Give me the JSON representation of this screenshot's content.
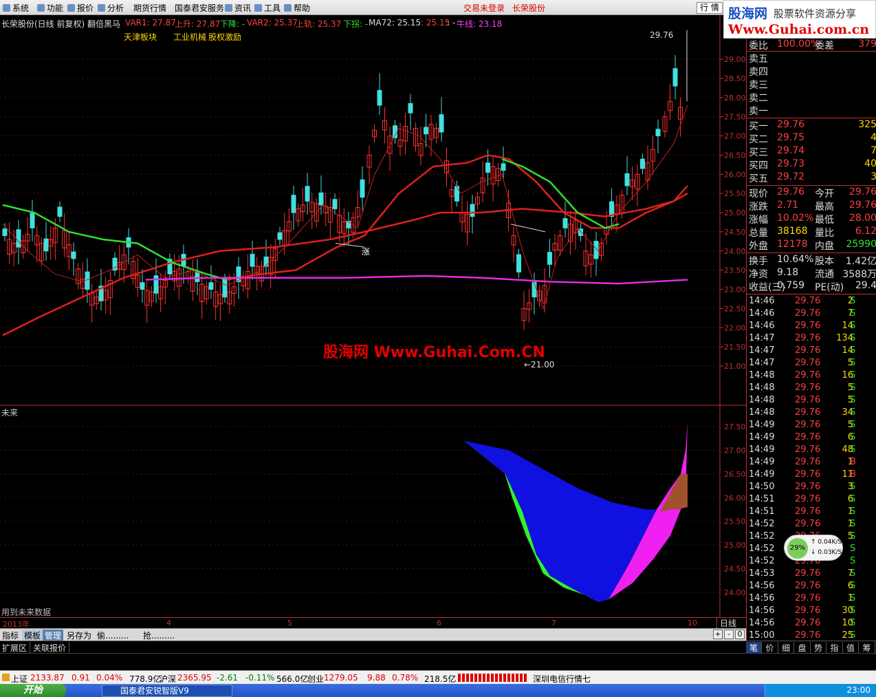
{
  "menu": {
    "items": [
      "系统",
      "功能",
      "报价",
      "分析",
      "期货行情",
      "国泰君安服务",
      "资讯",
      "工具",
      "帮助"
    ],
    "login_status": "交易未登录",
    "stock_name": "长荣股份",
    "hangqing": "行 情"
  },
  "logo": {
    "line1": "股海网",
    "line2": "股票软件资源分享",
    "line3": "Www.Guhai.com.cn"
  },
  "chart": {
    "title": "长荣股份(日线 前复权) 翻倍黑马",
    "indicators": [
      {
        "text": "VAR1: 27.87",
        "color": "#ff4040"
      },
      {
        "text": "上升: 27.87",
        "color": "#ff4040"
      },
      {
        "text": "下降: -",
        "color": "#30e030"
      },
      {
        "text": "VAR2: 25.37",
        "color": "#ff4040"
      },
      {
        "text": "上轨: 25.37",
        "color": "#ff4040"
      },
      {
        "text": "下拐: -",
        "color": "#30e030"
      },
      {
        "text": "MA72: 25.15",
        "color": "#dddddd"
      },
      {
        "text": ": 25.15",
        "color": "#ff4040"
      },
      {
        "text": ": -",
        "color": "#dddddd"
      },
      {
        "text": "牛线: 23.18",
        "color": "#ff40ff"
      }
    ],
    "blocks": [
      "天津板块",
      "工业机械",
      "股权激励"
    ],
    "high_label": "29.76",
    "low_label": "←21.00",
    "zhang_label": "涨",
    "watermark": "股海网 Www.Guhai.Com.CN",
    "price_axis": [
      "29.00",
      "28.50",
      "28.00",
      "27.50",
      "27.00",
      "26.50",
      "26.00",
      "25.50",
      "25.00",
      "24.50",
      "24.00",
      "23.50",
      "23.00",
      "22.50",
      "22.00",
      "21.50",
      "21.00"
    ],
    "future_axis": [
      "27.50",
      "27.00",
      "26.50",
      "26.00",
      "25.50",
      "25.00",
      "24.50",
      "24.00"
    ],
    "future_label": "未来",
    "future_note": "用到未来数据",
    "dates": [
      "2013年",
      "4",
      "5",
      "6",
      "7",
      "10"
    ],
    "period": "日线"
  },
  "tabs1": [
    "指标",
    "模板",
    "管理",
    "另存为",
    "偷.........",
    "抢........."
  ],
  "tabs1_buttons": [
    "+",
    "-",
    "0"
  ],
  "tabs2": [
    "扩展区",
    "关联报价"
  ],
  "quote": {
    "weibi": {
      "label": "委比",
      "value": "100.00%",
      "label2": "委差",
      "value2": "379"
    },
    "sell": [
      {
        "label": "卖五"
      },
      {
        "label": "卖四"
      },
      {
        "label": "卖三"
      },
      {
        "label": "卖二"
      },
      {
        "label": "卖一"
      }
    ],
    "buy": [
      {
        "label": "买一",
        "price": "29.76",
        "vol": "325"
      },
      {
        "label": "买二",
        "price": "29.75",
        "vol": "4"
      },
      {
        "label": "买三",
        "price": "29.74",
        "vol": "7"
      },
      {
        "label": "买四",
        "price": "29.73",
        "vol": "40"
      },
      {
        "label": "买五",
        "price": "29.72",
        "vol": "3"
      }
    ],
    "stats": [
      {
        "k": "现价",
        "v": "29.76",
        "vc": "#ff4040",
        "k2": "今开",
        "v2": "29.76",
        "v2c": "#ff4040"
      },
      {
        "k": "涨跌",
        "v": "2.71",
        "vc": "#ff4040",
        "k2": "最高",
        "v2": "29.76",
        "v2c": "#ff4040"
      },
      {
        "k": "涨幅",
        "v": "10.02%",
        "vc": "#ff4040",
        "k2": "最低",
        "v2": "28.00",
        "v2c": "#ff4040"
      },
      {
        "k": "总量",
        "v": "38168",
        "vc": "#ffd700",
        "k2": "量比",
        "v2": "6.12",
        "v2c": "#ff4040"
      },
      {
        "k": "外盘",
        "v": "12178",
        "vc": "#ff4040",
        "k2": "内盘",
        "v2": "25990",
        "v2c": "#30e030"
      }
    ],
    "stats2": [
      {
        "k": "换手",
        "v": "10.64%",
        "vc": "#dddddd",
        "k2": "股本",
        "v2": "1.42亿",
        "v2c": "#dddddd"
      },
      {
        "k": "净资",
        "v": "9.18",
        "vc": "#dddddd",
        "k2": "流通",
        "v2": "3588万",
        "v2c": "#dddddd"
      },
      {
        "k": "收益(三)",
        "v": "0.759",
        "vc": "#dddddd",
        "k2": "PE(动)",
        "v2": "29.4",
        "v2c": "#dddddd"
      }
    ],
    "ticks": [
      {
        "t": "14:46",
        "p": "29.76",
        "v": "2",
        "bs": "S"
      },
      {
        "t": "14:46",
        "p": "29.76",
        "v": "7",
        "bs": "S"
      },
      {
        "t": "14:46",
        "p": "29.76",
        "v": "14",
        "bs": "S"
      },
      {
        "t": "14:47",
        "p": "29.76",
        "v": "134",
        "bs": "S"
      },
      {
        "t": "14:47",
        "p": "29.76",
        "v": "14",
        "bs": "S"
      },
      {
        "t": "14:47",
        "p": "29.76",
        "v": "5",
        "bs": "S"
      },
      {
        "t": "14:48",
        "p": "29.76",
        "v": "16",
        "bs": "S"
      },
      {
        "t": "14:48",
        "p": "29.76",
        "v": "5",
        "bs": "S"
      },
      {
        "t": "14:48",
        "p": "29.76",
        "v": "5",
        "bs": "S"
      },
      {
        "t": "14:48",
        "p": "29.76",
        "v": "34",
        "bs": "S"
      },
      {
        "t": "14:49",
        "p": "29.76",
        "v": "5",
        "bs": "S"
      },
      {
        "t": "14:49",
        "p": "29.76",
        "v": "6",
        "bs": "S"
      },
      {
        "t": "14:49",
        "p": "29.76",
        "v": "48",
        "bs": "S"
      },
      {
        "t": "14:49",
        "p": "29.76",
        "v": "1",
        "bs": "B"
      },
      {
        "t": "14:49",
        "p": "29.76",
        "v": "11",
        "bs": "B"
      },
      {
        "t": "14:50",
        "p": "29.76",
        "v": "3",
        "bs": "S"
      },
      {
        "t": "14:51",
        "p": "29.76",
        "v": "6",
        "bs": "S"
      },
      {
        "t": "14:51",
        "p": "29.76",
        "v": "1",
        "bs": "S"
      },
      {
        "t": "14:52",
        "p": "29.76",
        "v": "1",
        "bs": "S"
      },
      {
        "t": "14:52",
        "p": "29.76",
        "v": "5",
        "bs": "S"
      },
      {
        "t": "14:52",
        "p": "29.76",
        "v": "",
        "bs": "S"
      },
      {
        "t": "14:52",
        "p": "29.76",
        "v": "",
        "bs": "S"
      },
      {
        "t": "14:53",
        "p": "29.76",
        "v": "7",
        "bs": "S"
      },
      {
        "t": "14:56",
        "p": "29.76",
        "v": "6",
        "bs": "S"
      },
      {
        "t": "14:56",
        "p": "29.76",
        "v": "1",
        "bs": "S"
      },
      {
        "t": "14:56",
        "p": "29.76",
        "v": "30",
        "bs": "S"
      },
      {
        "t": "14:56",
        "p": "29.76",
        "v": "10",
        "bs": "S"
      },
      {
        "t": "15:00",
        "p": "29.76",
        "v": "25",
        "bs": "S"
      }
    ],
    "speed": {
      "pct": "29%",
      "up": "0.04K/S",
      "down": "0.03K/S"
    }
  },
  "rtabs": [
    "笔",
    "价",
    "细",
    "盘",
    "势",
    "指",
    "值",
    "筹"
  ],
  "status": [
    {
      "text": "上证",
      "c": "#000000"
    },
    {
      "text": "2133.87",
      "c": "#e00000"
    },
    {
      "text": "0.91",
      "c": "#e00000"
    },
    {
      "text": "0.04%",
      "c": "#e00000"
    },
    {
      "text": "778.9亿",
      "c": "#000000"
    },
    {
      "text": "沪深",
      "c": "#000000"
    },
    {
      "text": "2365.95",
      "c": "#e00000"
    },
    {
      "text": "-2.61",
      "c": "#008000"
    },
    {
      "text": "-0.11%",
      "c": "#008000"
    },
    {
      "text": "566.0亿",
      "c": "#000000"
    },
    {
      "text": "创业",
      "c": "#000000"
    },
    {
      "text": "1279.05",
      "c": "#e00000"
    },
    {
      "text": "9.88",
      "c": "#e00000"
    },
    {
      "text": "0.78%",
      "c": "#e00000"
    },
    {
      "text": "218.5亿",
      "c": "#000000"
    },
    {
      "text": "深圳电信行情七",
      "c": "#000000"
    }
  ],
  "taskbar": {
    "start": "开始",
    "item": "国泰君安锐智版V9",
    "clock": "23:00"
  }
}
